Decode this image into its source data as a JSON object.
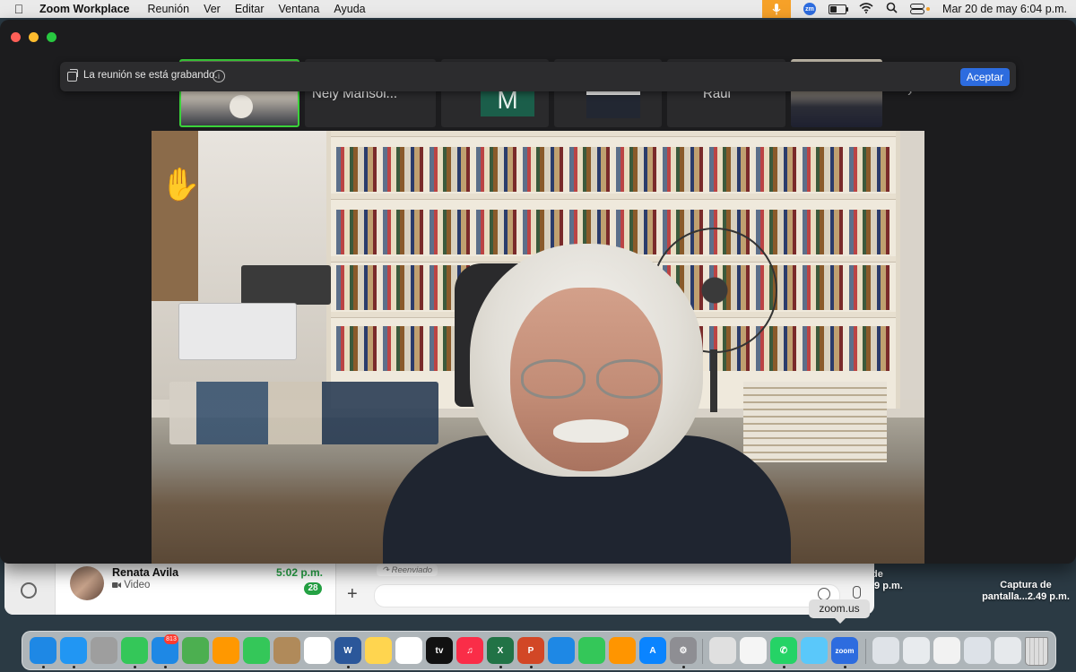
{
  "menubar": {
    "app_name": "Zoom Workplace",
    "menus": [
      "Reunión",
      "Ver",
      "Editar",
      "Ventana",
      "Ayuda"
    ],
    "datetime": "Mar 20 de may  6:04 p.m.",
    "zm_badge": "zm",
    "battery_level": 0.45
  },
  "desktop": {
    "file_label_1": "Captura de\npantalla...2.49 p.m.",
    "file_label_2_partial": "de\n.9 p.m."
  },
  "whatsapp": {
    "contact_name": "Renata Avila",
    "contact_sub": "Video",
    "contact_time": "5:02 p.m.",
    "unread_count": "28",
    "forwarded_label": "Reenviado"
  },
  "zoom": {
    "recording_banner": "La reunión se está grabando.",
    "accept_label": "Aceptar",
    "participants": [
      {
        "name": "Nely Mansol..."
      },
      {
        "initial": "M"
      },
      {
        "name": "Raúl"
      }
    ],
    "reaction_icon": "raised-hand-icon"
  },
  "dock": {
    "tooltip": "zoom.us",
    "mail_badge": "813",
    "apps": [
      {
        "name": "finder",
        "color": "#1e88e5"
      },
      {
        "name": "safari",
        "color": "#2196f3"
      },
      {
        "name": "launchpad",
        "color": "#9e9e9e"
      },
      {
        "name": "messages",
        "color": "#34c759"
      },
      {
        "name": "mail",
        "color": "#1e88e5"
      },
      {
        "name": "maps",
        "color": "#4caf50"
      },
      {
        "name": "photos",
        "color": "#ff9800"
      },
      {
        "name": "facetime",
        "color": "#34c759"
      },
      {
        "name": "contacts",
        "color": "#b08a5a"
      },
      {
        "name": "reminders",
        "color": "#ffffff"
      },
      {
        "name": "word",
        "color": "#2b579a"
      },
      {
        "name": "notes",
        "color": "#ffd54f"
      },
      {
        "name": "freeform",
        "color": "#ffffff"
      },
      {
        "name": "apple-tv",
        "color": "#111111"
      },
      {
        "name": "music",
        "color": "#fa2d48"
      },
      {
        "name": "excel",
        "color": "#217346"
      },
      {
        "name": "powerpoint",
        "color": "#d24726"
      },
      {
        "name": "keynote",
        "color": "#1e88e5"
      },
      {
        "name": "numbers",
        "color": "#34c759"
      },
      {
        "name": "pages",
        "color": "#ff9500"
      },
      {
        "name": "app-store",
        "color": "#0a84ff"
      },
      {
        "name": "system-settings",
        "color": "#8e8e93"
      },
      {
        "name": "preview",
        "color": "#e0e0e0"
      },
      {
        "name": "textedit",
        "color": "#f5f5f5"
      },
      {
        "name": "whatsapp",
        "color": "#25d366"
      },
      {
        "name": "finder-alt",
        "color": "#5ac8fa"
      },
      {
        "name": "zoom",
        "color": "#2d6cdf"
      }
    ],
    "apple_tv_label": "tv",
    "word_label": "W",
    "excel_label": "X",
    "powerpoint_label": "P",
    "zoom_label": "zoom"
  }
}
